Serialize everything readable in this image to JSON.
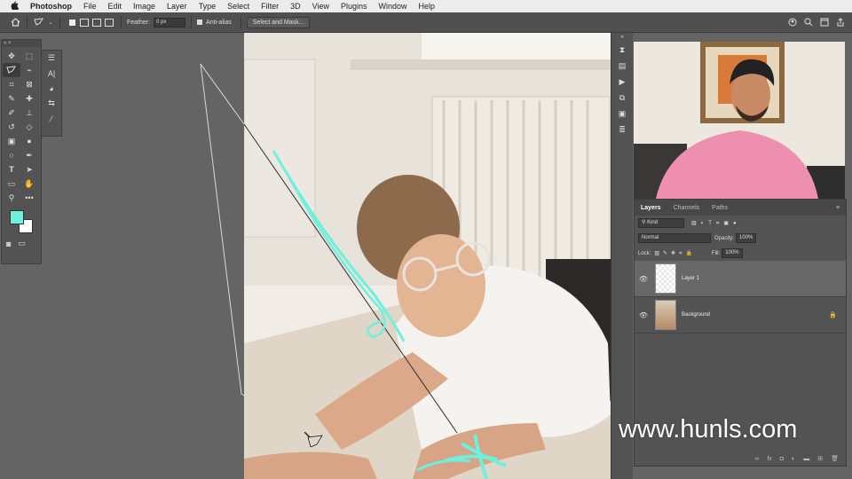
{
  "menubar": {
    "apple": "",
    "app_name": "Photoshop",
    "items": [
      "File",
      "Edit",
      "Image",
      "Layer",
      "Type",
      "Select",
      "Filter",
      "3D",
      "View",
      "Plugins",
      "Window",
      "Help"
    ]
  },
  "options_bar": {
    "feather_label": "Feather:",
    "feather_value": "0 px",
    "anti_alias_label": "Anti-alias",
    "select_mask_label": "Select and Mask..."
  },
  "toolbar": {
    "header": "» ×",
    "tools": [
      "move",
      "marquee",
      "polygonal-lasso",
      "quick-select",
      "crop",
      "frame",
      "eyedropper",
      "healing",
      "brush",
      "stamp",
      "history-brush",
      "eraser",
      "gradient",
      "blur",
      "dodge",
      "pen",
      "type",
      "path-select",
      "rectangle",
      "hand",
      "zoom",
      "more"
    ],
    "foreground_color": "#6ef0dc",
    "background_color": "#ffffff"
  },
  "layers_panel": {
    "tabs": [
      "Layers",
      "Channels",
      "Paths"
    ],
    "filter_kind": "Kind",
    "blend_mode": "Normal",
    "opacity_label": "Opacity:",
    "opacity_value": "100%",
    "lock_label": "Lock:",
    "fill_label": "Fill:",
    "fill_value": "100%",
    "layers": [
      {
        "name": "Layer 1",
        "selected": true
      },
      {
        "name": "Background",
        "selected": false
      }
    ]
  },
  "watermark": "www.hunls.com",
  "colors": {
    "accent_stroke": "#6ef0dc"
  }
}
